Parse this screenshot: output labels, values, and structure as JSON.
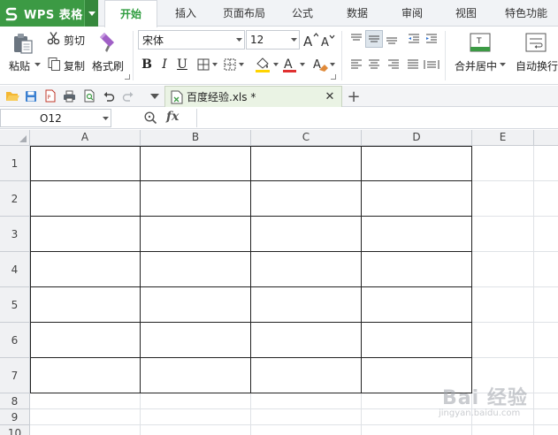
{
  "app": {
    "title": "WPS 表格"
  },
  "menu": {
    "tabs": [
      {
        "label": "开始",
        "active": true
      },
      {
        "label": "插入"
      },
      {
        "label": "页面布局"
      },
      {
        "label": "公式"
      },
      {
        "label": "数据"
      },
      {
        "label": "审阅"
      },
      {
        "label": "视图"
      },
      {
        "label": "特色功能"
      }
    ]
  },
  "ribbon": {
    "paste_label": "粘贴",
    "cut_label": "剪切",
    "copy_label": "复制",
    "format_painter_label": "格式刷",
    "font_name": "宋体",
    "font_size": "12",
    "merge_center_label": "合并居中",
    "wrap_text_label": "自动换行",
    "bold_label": "B",
    "italic_label": "I",
    "underline_label": "U"
  },
  "document": {
    "tab_name": "百度经验.xls *"
  },
  "formula_bar": {
    "name_box": "O12",
    "fx_label": "fx",
    "formula": ""
  },
  "sheet": {
    "columns": [
      "A",
      "B",
      "C",
      "D",
      "E"
    ],
    "rows": [
      "1",
      "2",
      "3",
      "4",
      "5",
      "6",
      "7",
      "8",
      "9",
      "10"
    ]
  },
  "watermark": {
    "main": "Bai 经验",
    "url": "jingyan.baidu.com"
  },
  "colors": {
    "brand": "#3c9a44",
    "active_tab": "#2e9c3e"
  }
}
